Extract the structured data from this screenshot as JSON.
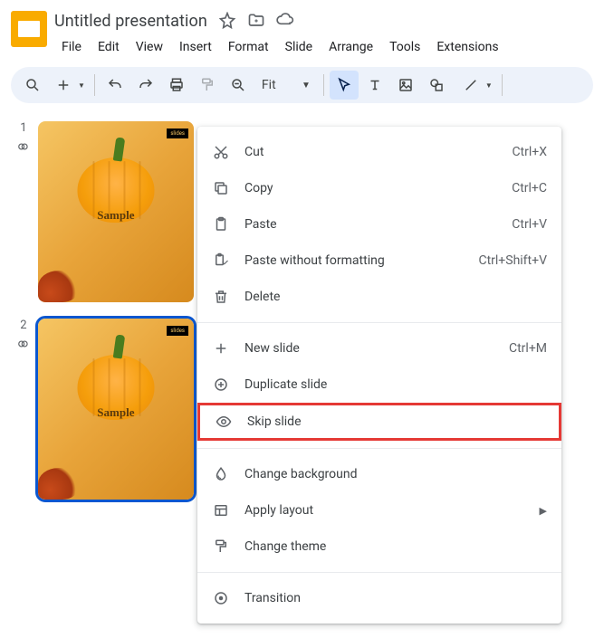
{
  "doc": {
    "title": "Untitled presentation"
  },
  "menubar": [
    "File",
    "Edit",
    "View",
    "Insert",
    "Format",
    "Slide",
    "Arrange",
    "Tools",
    "Extensions"
  ],
  "toolbar": {
    "zoom_label": "Fit"
  },
  "slides": [
    {
      "number": "1",
      "sample_label": "Sample",
      "watermark": "slides",
      "selected": false
    },
    {
      "number": "2",
      "sample_label": "Sample",
      "watermark": "slides",
      "selected": true
    }
  ],
  "context_menu": {
    "items": [
      {
        "icon": "cut",
        "label": "Cut",
        "shortcut": "Ctrl+X"
      },
      {
        "icon": "copy",
        "label": "Copy",
        "shortcut": "Ctrl+C"
      },
      {
        "icon": "paste",
        "label": "Paste",
        "shortcut": "Ctrl+V"
      },
      {
        "icon": "paste-plain",
        "label": "Paste without formatting",
        "shortcut": "Ctrl+Shift+V"
      },
      {
        "icon": "delete",
        "label": "Delete",
        "shortcut": ""
      },
      {
        "sep": true
      },
      {
        "icon": "plus",
        "label": "New slide",
        "shortcut": "Ctrl+M"
      },
      {
        "icon": "duplicate",
        "label": "Duplicate slide",
        "shortcut": ""
      },
      {
        "icon": "eye",
        "label": "Skip slide",
        "shortcut": "",
        "highlighted": true
      },
      {
        "sep": true
      },
      {
        "icon": "droplet",
        "label": "Change background",
        "shortcut": ""
      },
      {
        "icon": "layout",
        "label": "Apply layout",
        "shortcut": "",
        "submenu": true
      },
      {
        "icon": "theme",
        "label": "Change theme",
        "shortcut": ""
      },
      {
        "sep": true
      },
      {
        "icon": "transition",
        "label": "Transition",
        "shortcut": ""
      }
    ]
  }
}
